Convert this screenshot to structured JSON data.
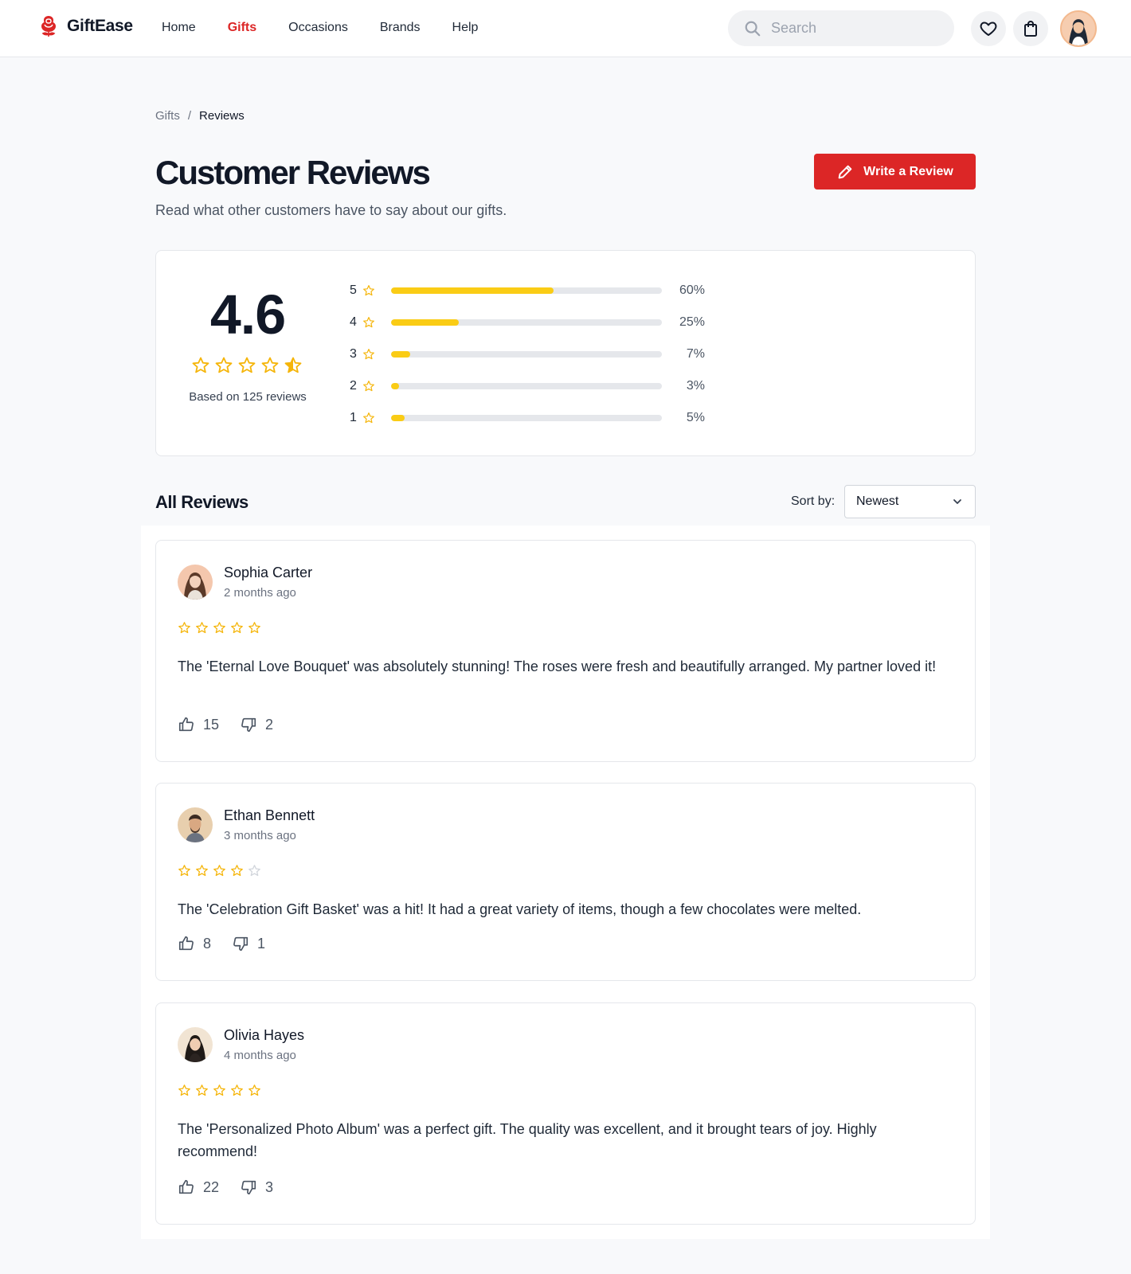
{
  "brand": {
    "name": "GiftEase",
    "color": "#dc2626",
    "icon": "rose-icon"
  },
  "nav": [
    {
      "label": "Home",
      "active": false
    },
    {
      "label": "Gifts",
      "active": true
    },
    {
      "label": "Occasions",
      "active": false
    },
    {
      "label": "Brands",
      "active": false
    },
    {
      "label": "Help",
      "active": false
    }
  ],
  "search": {
    "placeholder": "Search",
    "icon": "search-icon"
  },
  "header_actions": {
    "wishlist_icon": "heart-icon",
    "cart_icon": "shopping-bag-icon",
    "avatar": "user-avatar"
  },
  "breadcrumb": {
    "parent": "Gifts",
    "separator": "/",
    "current": "Reviews"
  },
  "page": {
    "title": "Customer Reviews",
    "subtitle": "Read what other customers have to say about our gifts.",
    "write_button": "Write a Review"
  },
  "summary": {
    "average": "4.6",
    "average_stars": 4.5,
    "based_on": "Based on 125 reviews",
    "distribution": [
      {
        "stars": "5",
        "percent_label": "60%",
        "percent": 60
      },
      {
        "stars": "4",
        "percent_label": "25%",
        "percent": 25
      },
      {
        "stars": "3",
        "percent_label": "7%",
        "percent": 7
      },
      {
        "stars": "2",
        "percent_label": "3%",
        "percent": 3
      },
      {
        "stars": "1",
        "percent_label": "5%",
        "percent": 5
      }
    ],
    "bar_color": "#facc15"
  },
  "reviews_section": {
    "title": "All Reviews",
    "sort_label": "Sort by:",
    "sort_value": "Newest"
  },
  "reviews": [
    {
      "name": "Sophia Carter",
      "time": "2 months ago",
      "rating": 5,
      "text": "The 'Eternal Love Bouquet' was absolutely stunning! The roses were fresh and beautifully arranged. My partner loved it!",
      "likes": "15",
      "dislikes": "2"
    },
    {
      "name": "Ethan Bennett",
      "time": "3 months ago",
      "rating": 4,
      "text": "The 'Celebration Gift Basket' was a hit! It had a great variety of items, though a few chocolates were melted.",
      "likes": "8",
      "dislikes": "1"
    },
    {
      "name": "Olivia Hayes",
      "time": "4 months ago",
      "rating": 5,
      "text": "The 'Personalized Photo Album' was a perfect gift. The quality was excellent, and it brought tears of joy. Highly recommend!",
      "likes": "22",
      "dislikes": "3"
    }
  ],
  "star_color": "#f5b50a",
  "star_empty_color": "#d1d5db"
}
